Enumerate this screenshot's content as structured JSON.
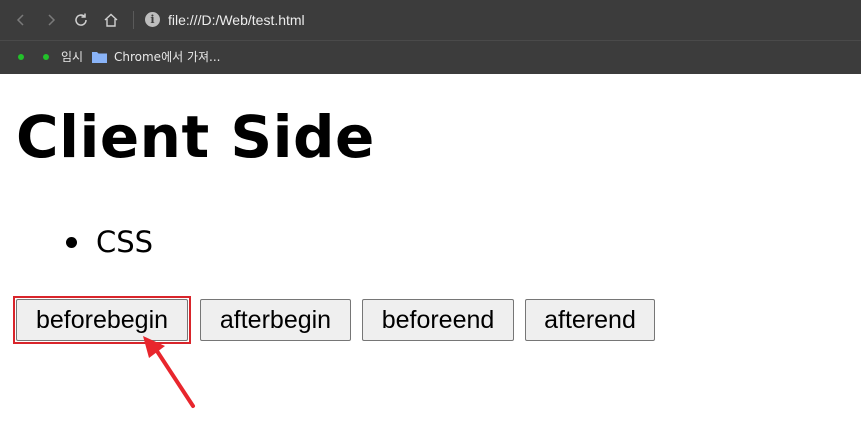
{
  "browser": {
    "url": "file:///D:/Web/test.html",
    "bookmarks": [
      {
        "label": "임시"
      },
      {
        "label": "Chrome에서 가져..."
      }
    ]
  },
  "page": {
    "heading": "Client Side",
    "list": [
      "CSS"
    ],
    "buttons": [
      "beforebegin",
      "afterbegin",
      "beforeend",
      "afterend"
    ]
  },
  "annotation": {
    "color": "#d9252b"
  }
}
